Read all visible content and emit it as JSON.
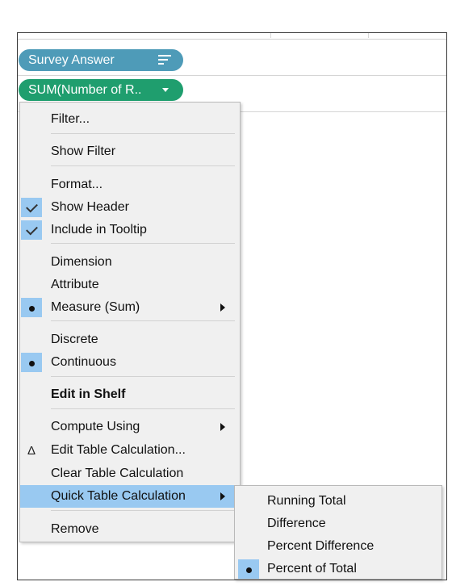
{
  "shelves": {
    "rows_pill": {
      "label": "Survey Answer",
      "icon": "sort-icon"
    },
    "measure_pill": {
      "label": "SUM(Number of R..",
      "icon": "chevron-down-icon"
    }
  },
  "context_menu": {
    "items": [
      {
        "label": "Filter..."
      },
      {
        "label": "Show Filter"
      },
      {
        "label": "Format..."
      },
      {
        "label": "Show Header",
        "checked": true
      },
      {
        "label": "Include in Tooltip",
        "checked": true
      },
      {
        "label": "Dimension"
      },
      {
        "label": "Attribute"
      },
      {
        "label": "Measure (Sum)",
        "selected": true,
        "submenu": true
      },
      {
        "label": "Discrete"
      },
      {
        "label": "Continuous",
        "selected": true
      },
      {
        "label": "Edit in Shelf",
        "bold": true
      },
      {
        "label": "Compute Using",
        "submenu": true
      },
      {
        "label": "Edit Table Calculation...",
        "icon": "delta-icon"
      },
      {
        "label": "Clear Table Calculation"
      },
      {
        "label": "Quick Table Calculation",
        "highlighted": true,
        "submenu": true
      },
      {
        "label": "Remove"
      }
    ]
  },
  "quick_table_calc_submenu": {
    "items": [
      {
        "label": "Running Total"
      },
      {
        "label": "Difference"
      },
      {
        "label": "Percent Difference"
      },
      {
        "label": "Percent of Total",
        "selected": true
      }
    ]
  },
  "colors": {
    "dimension_pill": "#4e9bb8",
    "measure_pill": "#1f9e6e",
    "menu_highlight": "#99c9f1"
  }
}
